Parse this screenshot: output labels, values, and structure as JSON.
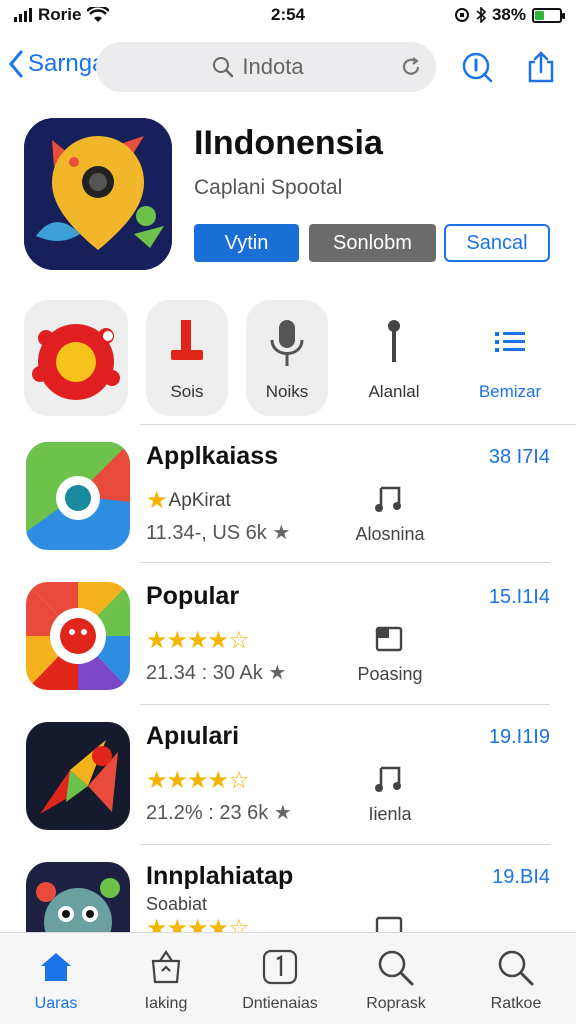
{
  "status": {
    "carrier": "Rorie",
    "time": "2:54",
    "battery": "38%",
    "battery_level": 0.38
  },
  "nav": {
    "back_label": "Sarnga",
    "search_text": "Indota"
  },
  "app": {
    "title": "IIndonensia",
    "subtitle": "Caplani Spootal",
    "buttons": [
      "Vytin",
      "Sonlobm",
      "Sancal"
    ]
  },
  "categories": [
    {
      "label": ""
    },
    {
      "label": "Sois"
    },
    {
      "label": "Noiks"
    },
    {
      "label": "Alanlal"
    },
    {
      "label": "Bemizar"
    }
  ],
  "apps": [
    {
      "name": "Applkaiass",
      "price": "38 I7I4",
      "sub": "ApKirat",
      "meta": "11.34-, US 6k",
      "category": "Alosnina",
      "rating": 1
    },
    {
      "name": "Popular",
      "price": "15.I1I4",
      "sub": "",
      "meta": "21.34 : 30 Ak",
      "category": "Poasing",
      "rating": 4
    },
    {
      "name": "Apıulari",
      "price": "19.I1I9",
      "sub": "",
      "meta": "21.2% : 23 6k",
      "category": "Iienla",
      "rating": 4
    },
    {
      "name": "Innplahiatap",
      "price": "19.BI4",
      "sub": "Soabiat",
      "meta": "",
      "category": "",
      "rating": 4
    }
  ],
  "tabs": [
    {
      "label": "Uaras",
      "active": true
    },
    {
      "label": "Iaking"
    },
    {
      "label": "Dntienaias"
    },
    {
      "label": "Roprask"
    },
    {
      "label": "Ratkoe"
    }
  ],
  "colors": {
    "accent": "#1a73e8",
    "star": "#f5b400"
  }
}
